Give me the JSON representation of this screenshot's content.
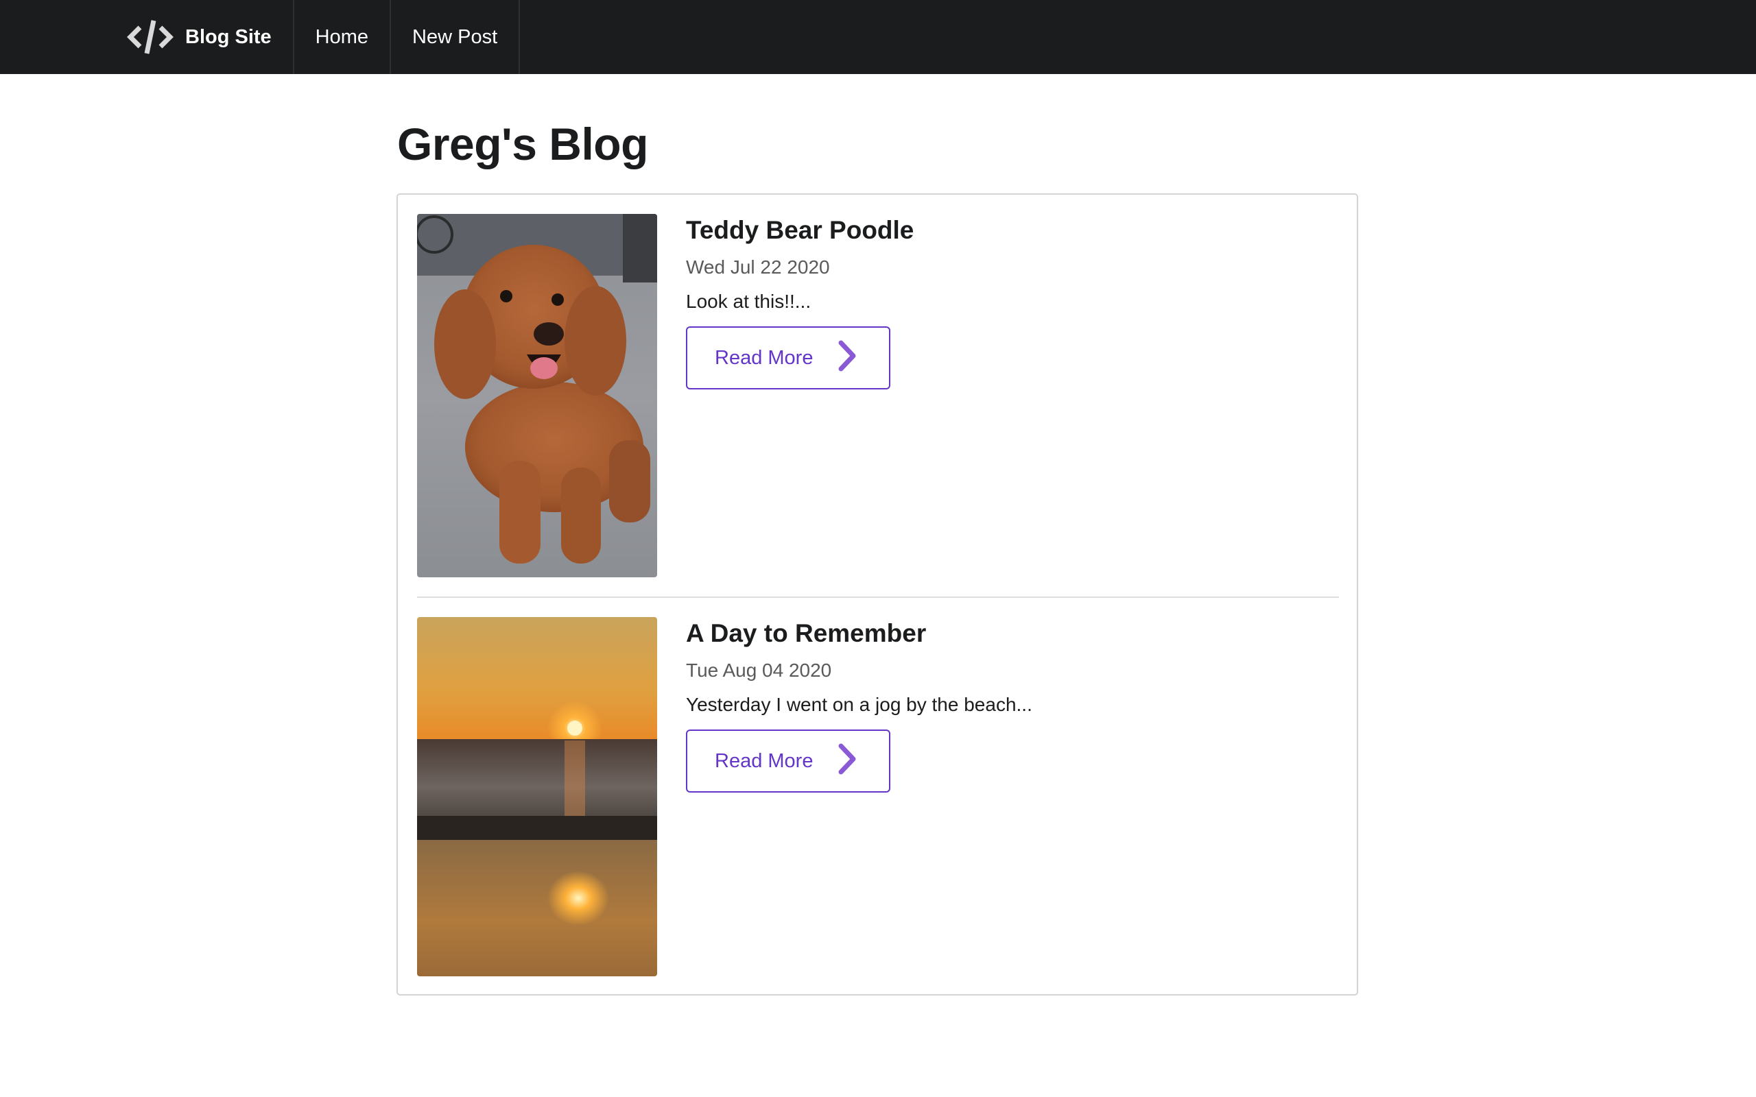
{
  "navbar": {
    "brand_label": "Blog Site",
    "brand_icon": "code-icon",
    "items": [
      {
        "label": "Home"
      },
      {
        "label": "New Post"
      }
    ]
  },
  "main": {
    "title": "Greg's Blog"
  },
  "posts": [
    {
      "title": "Teddy Bear Poodle",
      "date": "Wed Jul 22 2020",
      "excerpt": "Look at this!!...",
      "button_label": "Read More",
      "button_icon": "chevron-right-icon",
      "image": "poodle-photo"
    },
    {
      "title": "A Day to Remember",
      "date": "Tue Aug 04 2020",
      "excerpt": "Yesterday I went on a jog by the beach...",
      "button_label": "Read More",
      "button_icon": "chevron-right-icon",
      "image": "sunset-beach-photo"
    }
  ],
  "colors": {
    "navbar_bg": "#1b1c1d",
    "accent": "#6435c9",
    "border": "#d4d4d5",
    "muted_text": "#5a5a5a"
  }
}
